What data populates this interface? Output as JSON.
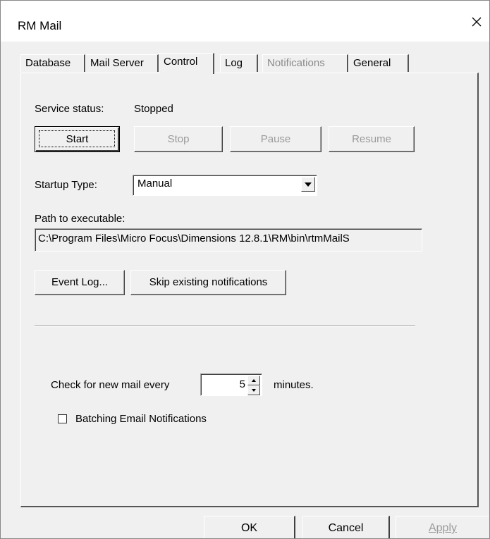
{
  "window": {
    "title": "RM Mail",
    "close_icon": "close-icon"
  },
  "tabs": [
    {
      "label": "Database",
      "active": false,
      "enabled": true
    },
    {
      "label": "Mail Server",
      "active": false,
      "enabled": true
    },
    {
      "label": "Control",
      "active": true,
      "enabled": true
    },
    {
      "label": "Log",
      "active": false,
      "enabled": true
    },
    {
      "label": "Notifications",
      "active": false,
      "enabled": false
    },
    {
      "label": "General",
      "active": false,
      "enabled": true
    }
  ],
  "service": {
    "status_label": "Service status:",
    "status_value": "Stopped",
    "buttons": {
      "start": "Start",
      "stop": "Stop",
      "pause": "Pause",
      "resume": "Resume"
    }
  },
  "startup": {
    "label": "Startup Type:",
    "value": "Manual",
    "arrow_icon": "dropdown-arrow-icon"
  },
  "path": {
    "label": "Path to executable:",
    "value": "C:\\Program Files\\Micro Focus\\Dimensions 12.8.1\\RM\\bin\\rtmMailS"
  },
  "actions": {
    "event_log": "Event Log...",
    "skip_notifications": "Skip existing notifications"
  },
  "check_mail": {
    "prefix": "Check for new mail every",
    "value": "5",
    "suffix": "minutes."
  },
  "batching": {
    "label": "Batching Email Notifications",
    "checked": false
  },
  "footer": {
    "ok": "OK",
    "cancel": "Cancel",
    "apply": "Apply"
  },
  "colors": {
    "dialog_bg": "#f0f0f0",
    "disabled_text": "#9a9a9a"
  }
}
